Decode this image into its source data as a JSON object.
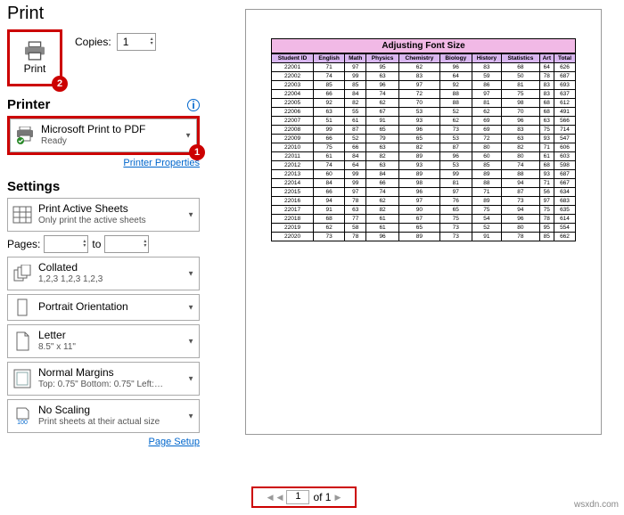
{
  "title": "Print",
  "print_button": "Print",
  "badge1": "1",
  "badge2": "2",
  "copies_label": "Copies:",
  "copies_value": "1",
  "printer_head": "Printer",
  "printer": {
    "name": "Microsoft Print to PDF",
    "status": "Ready"
  },
  "printer_props_link": "Printer Properties",
  "settings_head": "Settings",
  "s_active": {
    "main": "Print Active Sheets",
    "sub": "Only print the active sheets"
  },
  "pages_label": "Pages:",
  "pages_from": "",
  "to_label": "to",
  "pages_to": "",
  "s_collate": {
    "main": "Collated",
    "sub": "1,2,3   1,2,3   1,2,3"
  },
  "s_orient": {
    "main": "Portrait Orientation"
  },
  "s_paper": {
    "main": "Letter",
    "sub": "8.5\" x 11\""
  },
  "s_margin": {
    "main": "Normal Margins",
    "sub": "Top: 0.75\" Bottom: 0.75\" Left:…"
  },
  "s_scale": {
    "main": "No Scaling",
    "sub": "Print sheets at their actual size"
  },
  "page_setup_link": "Page Setup",
  "scale_icon_num": "100",
  "preview": {
    "title": "Adjusting Font Size",
    "headers": [
      "Student ID",
      "English",
      "Math",
      "Physics",
      "Chemistry",
      "Biology",
      "History",
      "Statistics",
      "Art",
      "Total"
    ],
    "rows": [
      [
        "22001",
        "71",
        "97",
        "95",
        "62",
        "96",
        "83",
        "68",
        "64",
        "626"
      ],
      [
        "22002",
        "74",
        "99",
        "63",
        "83",
        "64",
        "59",
        "50",
        "78",
        "687"
      ],
      [
        "22003",
        "85",
        "85",
        "96",
        "97",
        "92",
        "86",
        "81",
        "83",
        "693"
      ],
      [
        "22004",
        "66",
        "84",
        "74",
        "72",
        "88",
        "97",
        "75",
        "83",
        "637"
      ],
      [
        "22005",
        "92",
        "82",
        "62",
        "70",
        "88",
        "81",
        "98",
        "68",
        "612"
      ],
      [
        "22006",
        "63",
        "55",
        "67",
        "53",
        "52",
        "62",
        "70",
        "68",
        "491"
      ],
      [
        "22007",
        "51",
        "61",
        "91",
        "93",
        "62",
        "69",
        "96",
        "63",
        "566"
      ],
      [
        "22008",
        "99",
        "87",
        "65",
        "96",
        "73",
        "69",
        "83",
        "75",
        "714"
      ],
      [
        "22009",
        "66",
        "52",
        "79",
        "65",
        "53",
        "72",
        "63",
        "93",
        "547"
      ],
      [
        "22010",
        "75",
        "66",
        "63",
        "82",
        "87",
        "80",
        "82",
        "71",
        "606"
      ],
      [
        "22011",
        "61",
        "84",
        "82",
        "89",
        "96",
        "60",
        "80",
        "61",
        "603"
      ],
      [
        "22012",
        "74",
        "64",
        "63",
        "93",
        "53",
        "85",
        "74",
        "68",
        "598"
      ],
      [
        "22013",
        "60",
        "99",
        "84",
        "89",
        "99",
        "89",
        "88",
        "93",
        "687"
      ],
      [
        "22014",
        "84",
        "99",
        "66",
        "98",
        "81",
        "88",
        "94",
        "71",
        "667"
      ],
      [
        "22015",
        "66",
        "97",
        "74",
        "96",
        "97",
        "71",
        "87",
        "56",
        "634"
      ],
      [
        "22016",
        "94",
        "78",
        "62",
        "97",
        "76",
        "89",
        "73",
        "97",
        "683"
      ],
      [
        "22017",
        "91",
        "63",
        "82",
        "90",
        "65",
        "75",
        "94",
        "75",
        "635"
      ],
      [
        "22018",
        "68",
        "77",
        "61",
        "67",
        "75",
        "54",
        "96",
        "78",
        "614"
      ],
      [
        "22019",
        "62",
        "58",
        "61",
        "65",
        "73",
        "52",
        "80",
        "95",
        "554"
      ],
      [
        "22020",
        "73",
        "78",
        "96",
        "89",
        "73",
        "91",
        "78",
        "85",
        "662"
      ]
    ]
  },
  "pager": {
    "current": "1",
    "total": "of 1"
  },
  "watermark": "wsxdn.com"
}
